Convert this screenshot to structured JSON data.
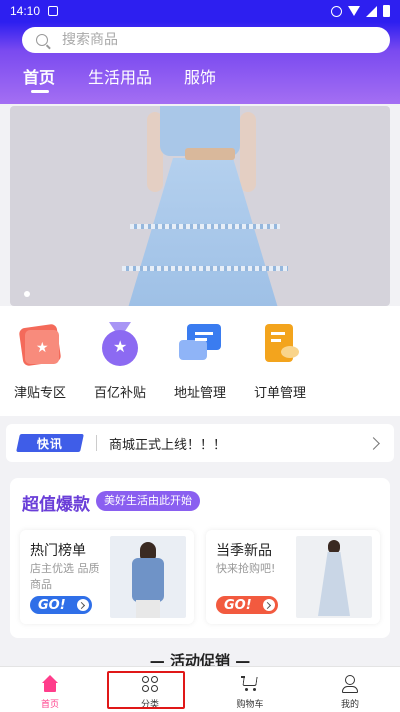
{
  "status_bar": {
    "time": "14:10"
  },
  "search": {
    "placeholder": "搜索商品"
  },
  "tabs": [
    {
      "label": "首页",
      "active": true
    },
    {
      "label": "生活用品",
      "active": false
    },
    {
      "label": "服饰",
      "active": false
    }
  ],
  "quick_links": [
    {
      "label": "津贴专区",
      "icon": "coupon-icon",
      "color": "#f46a5a"
    },
    {
      "label": "百亿补贴",
      "icon": "star-medal-icon",
      "color": "#8c6af2"
    },
    {
      "label": "地址管理",
      "icon": "chat-bubble-icon",
      "color": "#3a7cf0"
    },
    {
      "label": "订单管理",
      "icon": "order-list-icon",
      "color": "#f3a41d"
    }
  ],
  "notice": {
    "badge": "快讯",
    "text": "商城正式上线！！！"
  },
  "hot_section": {
    "title": "超值爆款",
    "subtitle": "美好生活由此开始",
    "cards": [
      {
        "title": "热门榜单",
        "desc": "店主优选 品质商品",
        "go": "GO!",
        "go_color": "#2f6fe8"
      },
      {
        "title": "当季新品",
        "desc": "快来抢购吧!",
        "go": "GO!",
        "go_color": "#f25a3f"
      }
    ]
  },
  "promo_title": "— 活动促销 —",
  "bottom_nav": [
    {
      "label": "首页",
      "icon": "home-icon",
      "active": true
    },
    {
      "label": "分类",
      "icon": "grid-icon",
      "active": false
    },
    {
      "label": "购物车",
      "icon": "cart-icon",
      "active": false
    },
    {
      "label": "我的",
      "icon": "user-icon",
      "active": false
    }
  ],
  "colors": {
    "primary": "#2d1ff0",
    "accent": "#ff3d8b",
    "purple": "#6a3ed8"
  }
}
